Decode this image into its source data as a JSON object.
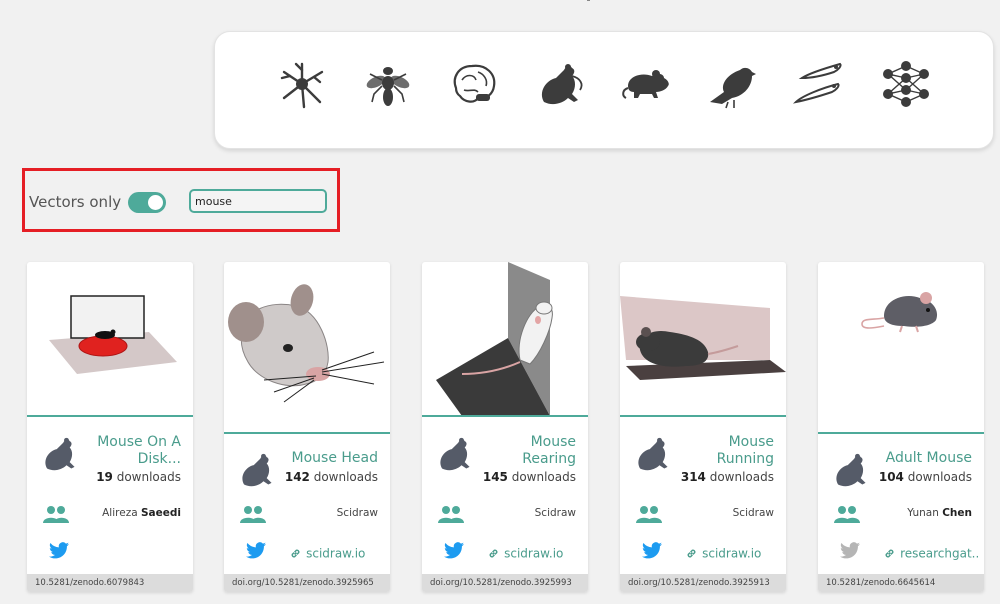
{
  "filters": {
    "vectors_label": "Vectors only",
    "vectors_enabled": true,
    "search_value": "mouse"
  },
  "categories": [
    {
      "icon": "neuron-icon"
    },
    {
      "icon": "fly-icon"
    },
    {
      "icon": "brain-icon"
    },
    {
      "icon": "rodent-icon"
    },
    {
      "icon": "mouse-icon"
    },
    {
      "icon": "bird-icon"
    },
    {
      "icon": "zebrafish-icon"
    },
    {
      "icon": "neural-network-icon"
    }
  ],
  "cards": [
    {
      "title": "Mouse On A Disk...",
      "downloads": "19",
      "downloads_label": " downloads",
      "author_first": "Alireza ",
      "author_last": "Saeedi",
      "link": "",
      "doi": "10.5281/zenodo.6079843"
    },
    {
      "title": "Mouse Head",
      "downloads": "142",
      "downloads_label": " downloads",
      "author_first": "Scidraw",
      "author_last": "",
      "link": "scidraw.io",
      "doi": "doi.org/10.5281/zenodo.3925965"
    },
    {
      "title": "Mouse Rearing",
      "downloads": "145",
      "downloads_label": " downloads",
      "author_first": "Scidraw",
      "author_last": "",
      "link": "scidraw.io",
      "doi": "doi.org/10.5281/zenodo.3925993"
    },
    {
      "title": "Mouse Running",
      "downloads": "314",
      "downloads_label": " downloads",
      "author_first": "Scidraw",
      "author_last": "",
      "link": "scidraw.io",
      "doi": "doi.org/10.5281/zenodo.3925913"
    },
    {
      "title": "Adult Mouse",
      "downloads": "104",
      "downloads_label": " downloads",
      "author_first": "Yunan ",
      "author_last": "Chen",
      "link": "researchgat...",
      "doi": "10.5281/zenodo.6645614"
    }
  ],
  "colors": {
    "accent": "#4eaa9a",
    "title": "#4a9c8c",
    "highlight": "#e51e25",
    "twitter": "#1d9bf0",
    "twitter_muted": "#b5b5b5"
  }
}
